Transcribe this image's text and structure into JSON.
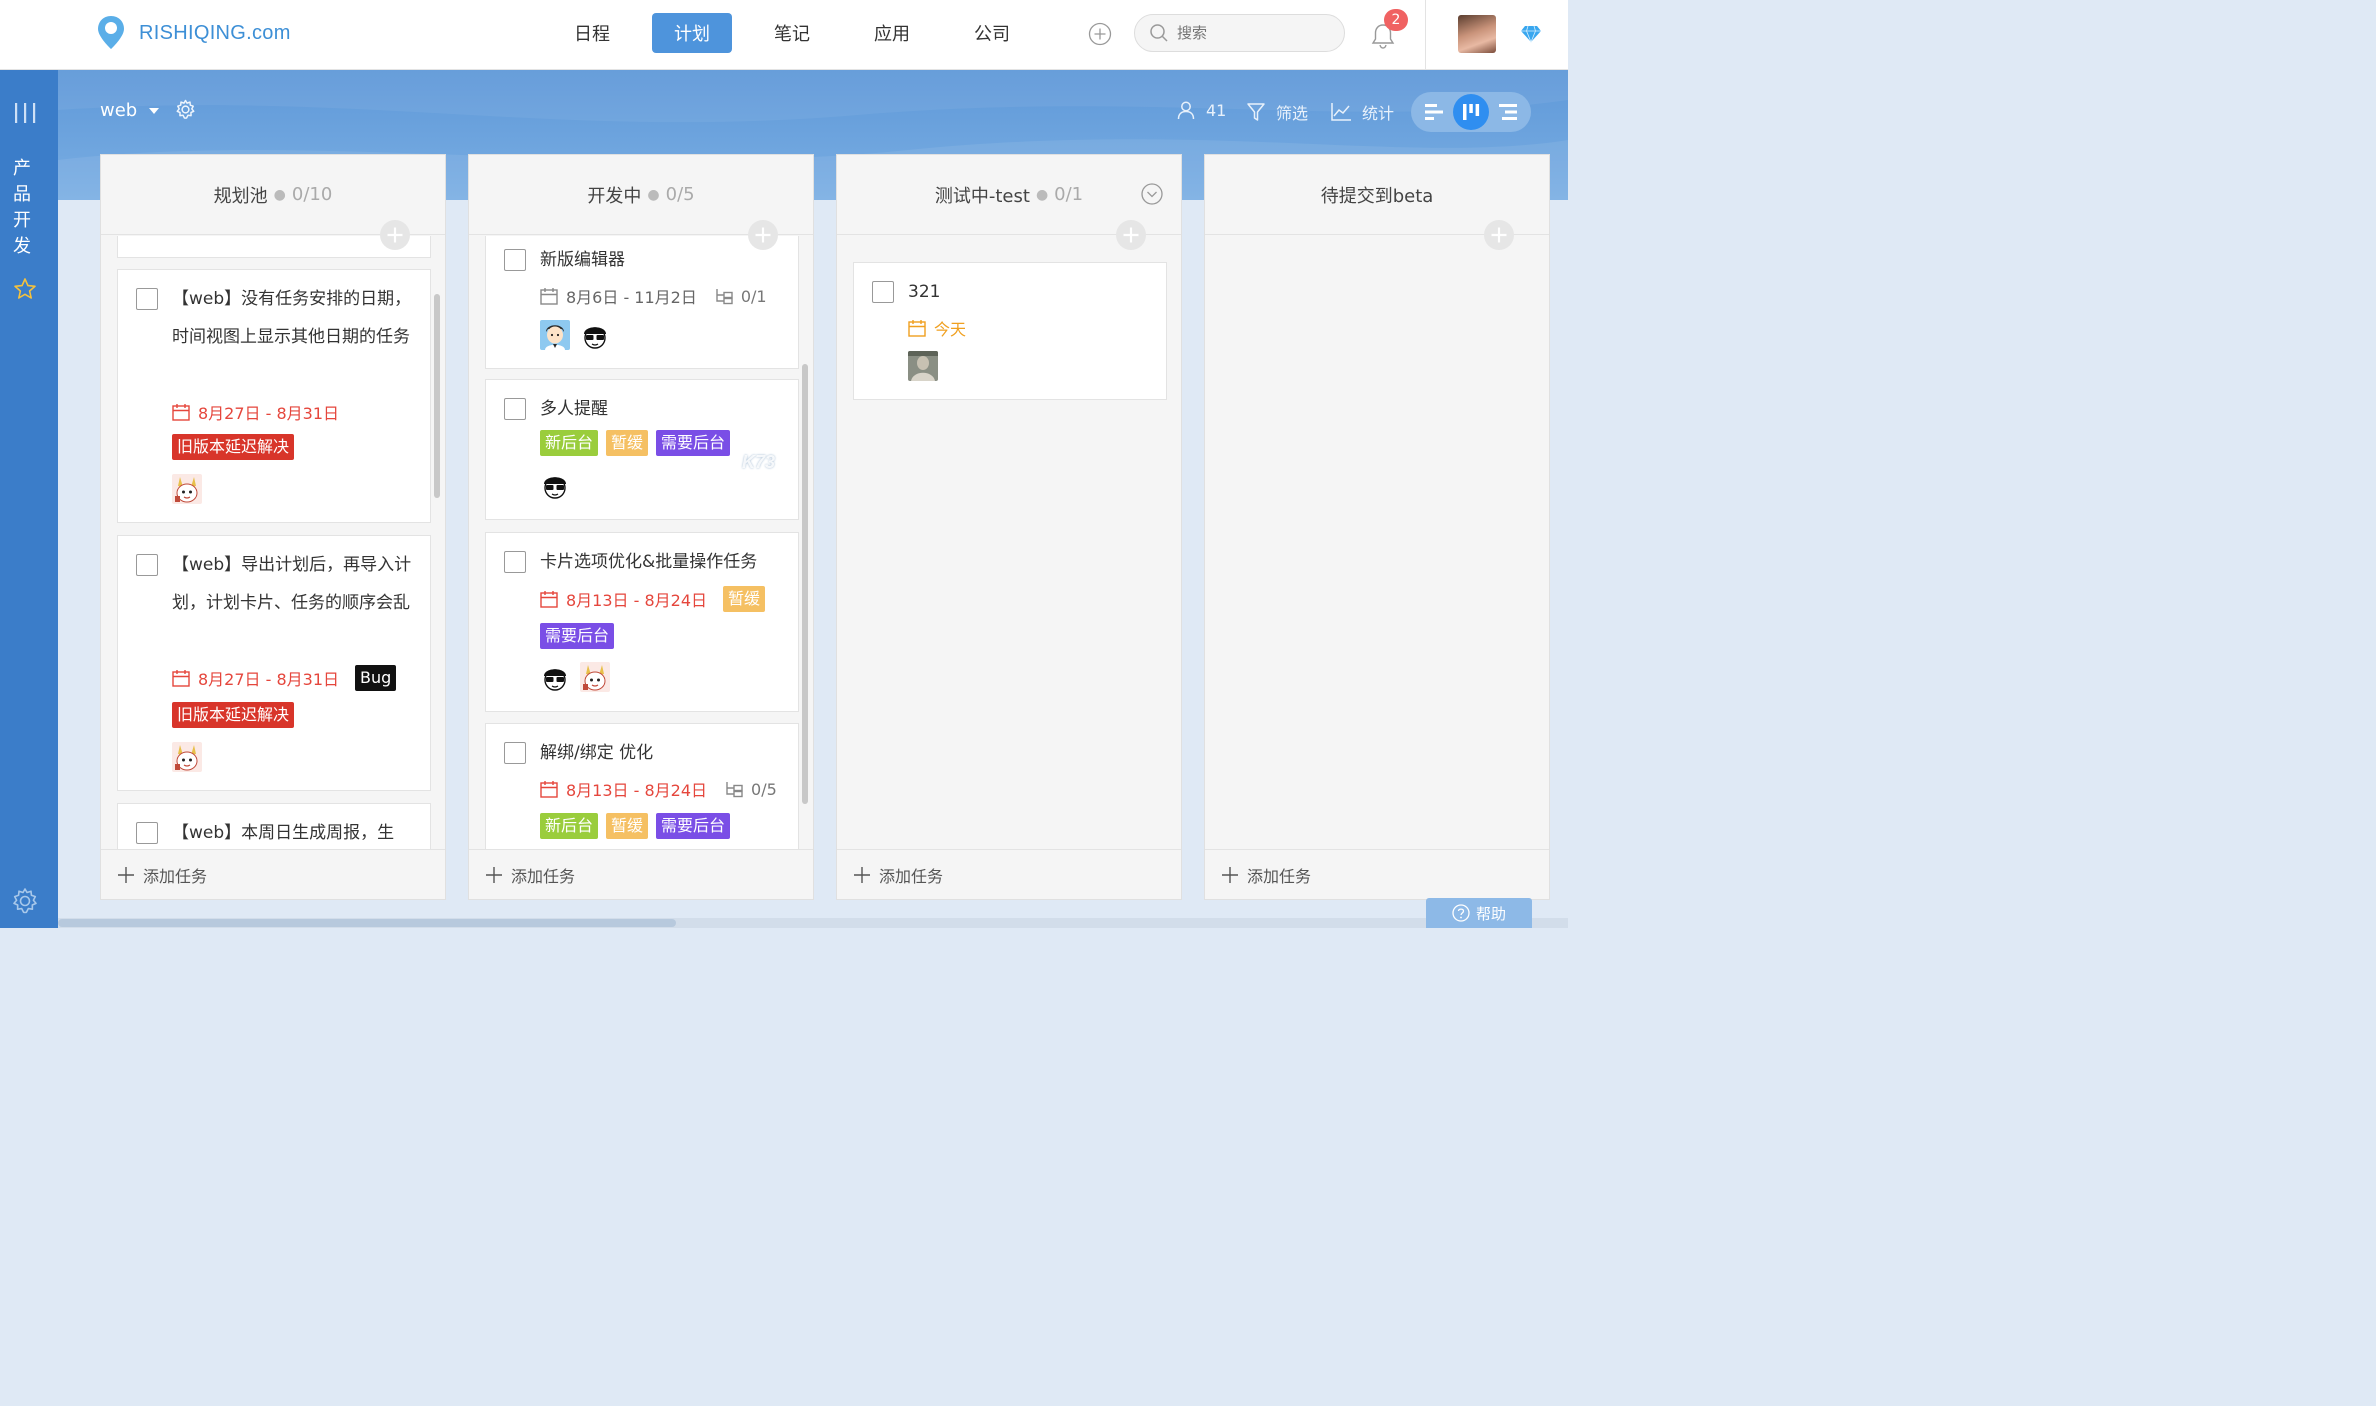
{
  "app": {
    "logo_text": "RISHIQING.com"
  },
  "nav": {
    "items": [
      "日程",
      "计划",
      "笔记",
      "应用",
      "公司"
    ],
    "active_index": 1
  },
  "search": {
    "placeholder": "搜索"
  },
  "notifications": {
    "count": "2"
  },
  "sidebar": {
    "project_label": [
      "产",
      "品",
      "开",
      "发"
    ]
  },
  "board": {
    "name": "web",
    "members_count": "41",
    "filter_label": "筛选",
    "stats_label": "统计",
    "views": [
      "list-view-icon",
      "board-view-icon",
      "gantt-view-icon"
    ],
    "active_view_index": 1
  },
  "colors": {
    "brand": "#3d8fd6",
    "nav_active": "#4e94dc",
    "tag_green": "#9acd3c",
    "tag_orange": "#f5c063",
    "tag_purple": "#7a4ee6",
    "tag_red": "#d8352a",
    "tag_black": "#111111",
    "date_red": "#e5463c",
    "date_orange": "#f0a020"
  },
  "columns": [
    {
      "title": "规划池",
      "count": "0/10",
      "add_task_label": "添加任务",
      "cards": [
        {
          "title": "【web】没有任务安排的日期，时间视图上显示其他日期的任务",
          "date": "8月27日 - 8月31日",
          "tags": [
            "旧版本延迟解决"
          ]
        },
        {
          "title": "【web】导出计划后，再导入计划，计划卡片、任务的顺序会乱",
          "date": "8月27日 - 8月31日",
          "inline_tag": "Bug",
          "tags": [
            "旧版本延迟解决"
          ]
        },
        {
          "title": "【web】本周日生成周报，生"
        }
      ]
    },
    {
      "title": "开发中",
      "count": "0/5",
      "add_task_label": "添加任务",
      "cards": [
        {
          "title": "新版编辑器",
          "date": "8月6日 - 11月2日",
          "subtasks": "0/1"
        },
        {
          "title": "多人提醒",
          "tags": [
            "新后台",
            "暂缓",
            "需要后台"
          ]
        },
        {
          "title": "卡片选项优化&批量操作任务",
          "date": "8月13日 - 8月24日",
          "inline_tag": "暂缓",
          "tags": [
            "需要后台"
          ]
        },
        {
          "title": "解绑/绑定 优化",
          "date": "8月13日 - 8月24日",
          "subtasks": "0/5",
          "tags": [
            "新后台",
            "暂缓",
            "需要后台"
          ]
        }
      ]
    },
    {
      "title": "测试中-test",
      "count": "0/1",
      "add_task_label": "添加任务",
      "cards": [
        {
          "title": "321",
          "date": "今天"
        }
      ]
    },
    {
      "title": "待提交到beta",
      "count": "",
      "add_task_label": "添加任务",
      "cards": []
    }
  ],
  "help": {
    "label": "帮助"
  },
  "watermark": "K73"
}
